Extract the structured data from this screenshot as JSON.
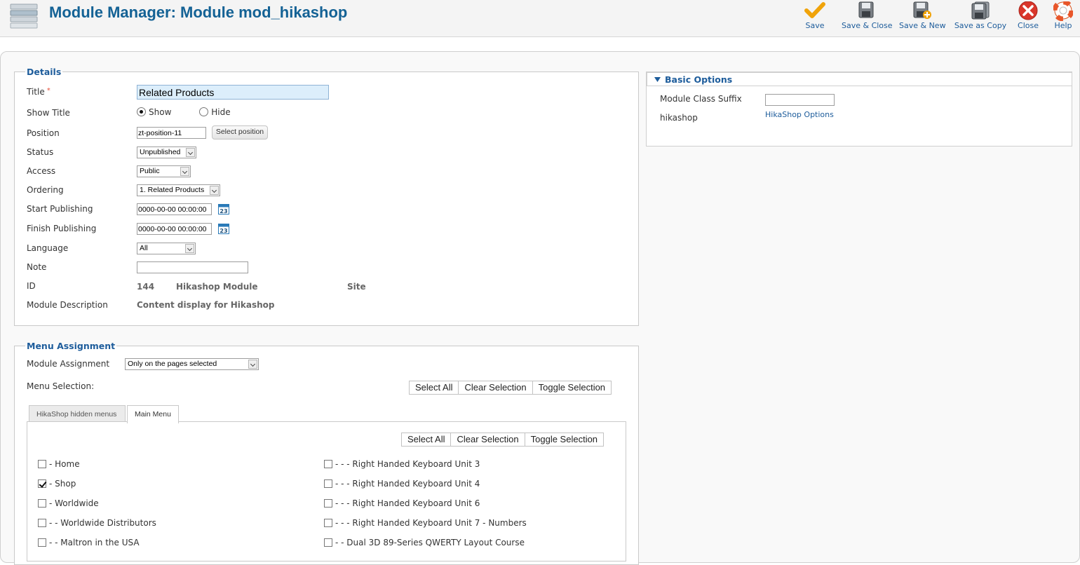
{
  "header": {
    "title": "Module Manager: Module mod_hikashop",
    "toolbar": {
      "save": "Save",
      "save_close": "Save & Close",
      "save_new": "Save & New",
      "save_copy": "Save as Copy",
      "close": "Close",
      "help": "Help"
    }
  },
  "details": {
    "legend": "Details",
    "title_label": "Title",
    "required_mark": "*",
    "title_value": "Related Products",
    "show_title_label": "Show Title",
    "show_option": "Show",
    "hide_option": "Hide",
    "show_title_selected": "Show",
    "position_label": "Position",
    "position_value": "zt-position-11",
    "select_position_button": "Select position",
    "status_label": "Status",
    "status_value": "Unpublished",
    "access_label": "Access",
    "access_value": "Public",
    "ordering_label": "Ordering",
    "ordering_value": "1. Related Products",
    "start_publishing_label": "Start Publishing",
    "start_publishing_value": "0000-00-00 00:00:00",
    "finish_publishing_label": "Finish Publishing",
    "finish_publishing_value": "0000-00-00 00:00:00",
    "calendar_day": "23",
    "language_label": "Language",
    "language_value": "All",
    "note_label": "Note",
    "note_value": "",
    "id_label": "ID",
    "id_value": "144",
    "module_type": "Hikashop Module",
    "client": "Site",
    "description_label": "Module Description",
    "description_value": "Content display for Hikashop"
  },
  "menu_assignment": {
    "legend": "Menu Assignment",
    "module_assignment_label": "Module Assignment",
    "module_assignment_value": "Only on the pages selected",
    "menu_selection_label": "Menu Selection:",
    "select_all": "Select All",
    "clear_selection": "Clear Selection",
    "toggle_selection": "Toggle Selection",
    "tabs": [
      {
        "label": "HikaShop hidden menus",
        "active": false
      },
      {
        "label": "Main Menu",
        "active": true
      }
    ],
    "items_left": [
      {
        "label": "- Home",
        "checked": false
      },
      {
        "label": "- Shop",
        "checked": true
      },
      {
        "label": "- Worldwide",
        "checked": false
      },
      {
        "label": "- - Worldwide Distributors",
        "checked": false
      },
      {
        "label": "- - Maltron in the USA",
        "checked": false
      }
    ],
    "items_right": [
      {
        "label": "- - - Right Handed Keyboard Unit 3",
        "checked": false
      },
      {
        "label": "- - - Right Handed Keyboard Unit 4",
        "checked": false
      },
      {
        "label": "- - - Right Handed Keyboard Unit 6",
        "checked": false
      },
      {
        "label": "- - - Right Handed Keyboard Unit 7 - Numbers",
        "checked": false
      },
      {
        "label": "- - Dual 3D 89-Series QWERTY Layout Course",
        "checked": false
      }
    ]
  },
  "basic_options": {
    "header": "Basic Options",
    "suffix_label": "Module Class Suffix",
    "suffix_value": "",
    "hikashop_label": "hikashop",
    "hikashop_options_link": "HikaShop Options"
  },
  "colors": {
    "title_blue": "#146295",
    "link_blue": "#1d5c9b",
    "save_check": "#f0a30a",
    "close_red": "#d9362b"
  }
}
